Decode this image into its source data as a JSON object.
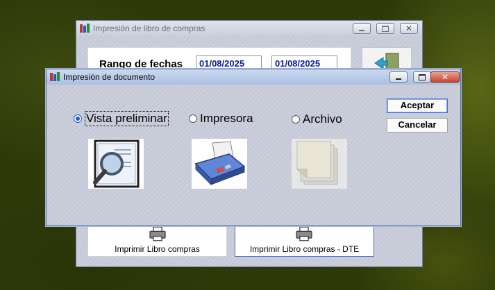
{
  "background_window": {
    "title": "Impresión de libro de compras",
    "range_label": "Rango de fechas",
    "date_from": "01/08/2025",
    "date_to": "01/08/2025",
    "print_buttons": [
      {
        "label": "Imprimir Libro compras"
      },
      {
        "label": "Imprimir Libro compras - DTE"
      }
    ]
  },
  "dialog": {
    "title": "Impresión de documento",
    "options": [
      {
        "label": "Vista preliminar",
        "checked": true,
        "icon": "print-preview-icon"
      },
      {
        "label": "Impresora",
        "checked": false,
        "icon": "printer-icon"
      },
      {
        "label": "Archivo",
        "checked": false,
        "icon": "file-icon"
      }
    ],
    "accept_label": "Aceptar",
    "cancel_label": "Cancelar"
  },
  "colors": {
    "accent": "#1d5fd1",
    "date_text": "#0a1a9c",
    "close_button": "#c8452f"
  }
}
